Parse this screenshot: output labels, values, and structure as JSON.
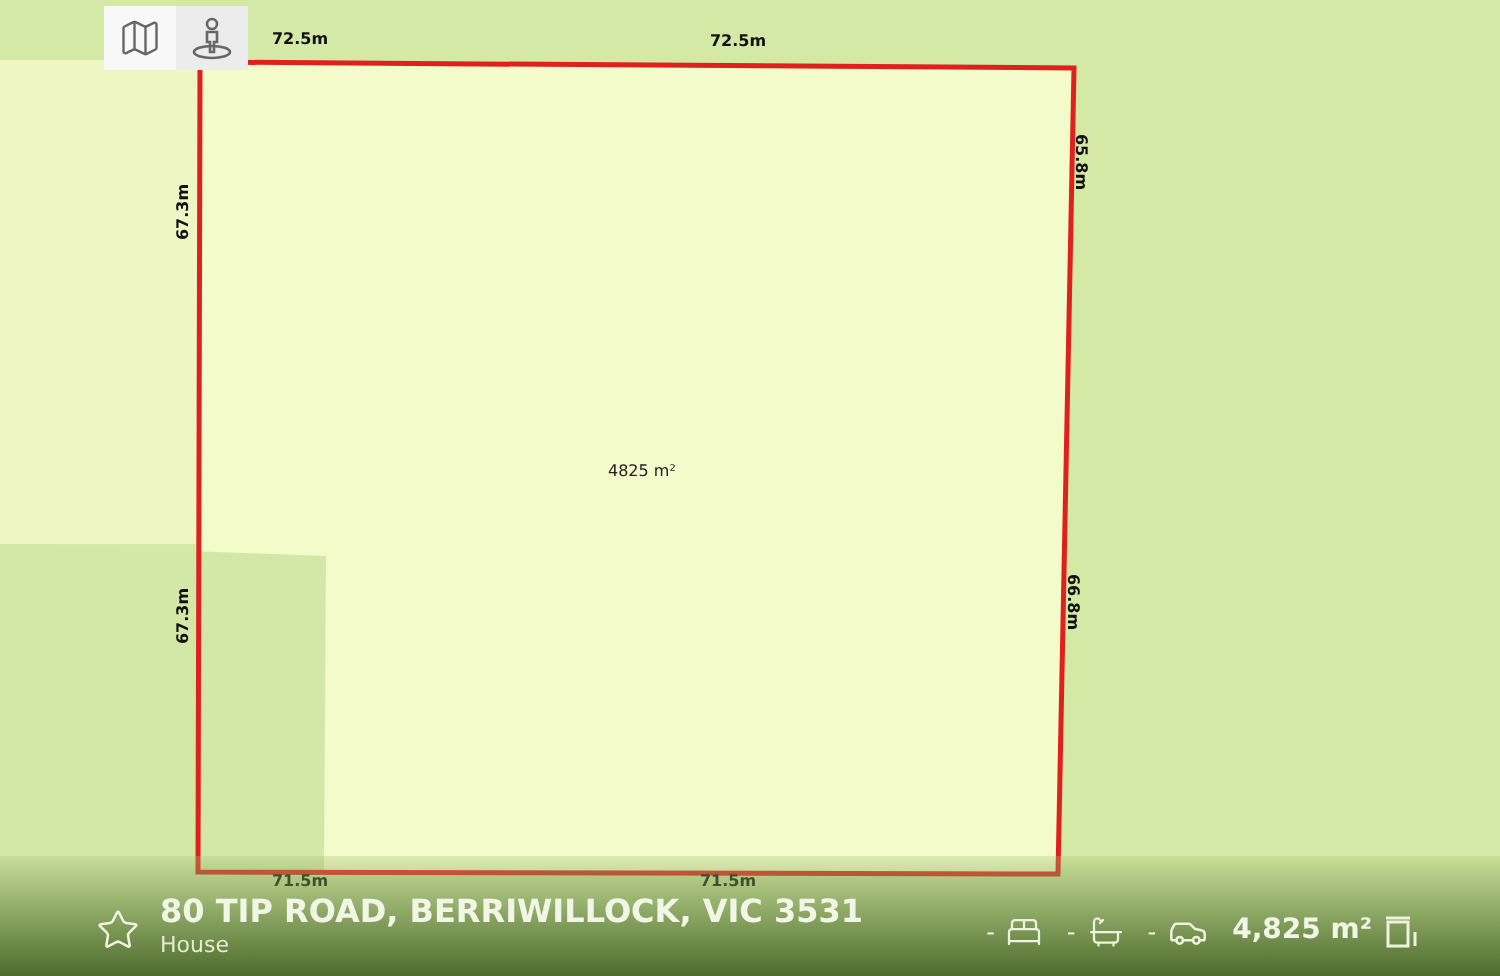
{
  "map_controls": [
    {
      "kind": "map",
      "selected": false
    },
    {
      "kind": "street",
      "selected": true
    }
  ],
  "lot": {
    "area": "4825 m²",
    "edge_labels": [
      "72.5m",
      "72.5m",
      "67.3m",
      "67.3m",
      "65.8m",
      "66.8m",
      "71.5m",
      "71.5m"
    ]
  },
  "listing": {
    "favourite": false,
    "address": "80 TIP ROAD, BERRIWILLOCK, VIC 3531",
    "type": "House",
    "features": [
      {
        "kind": "bed",
        "value": "-"
      },
      {
        "kind": "bath",
        "value": "-"
      },
      {
        "kind": "car",
        "value": "-"
      },
      {
        "kind": "land",
        "value": "4,825 m²"
      }
    ]
  }
}
